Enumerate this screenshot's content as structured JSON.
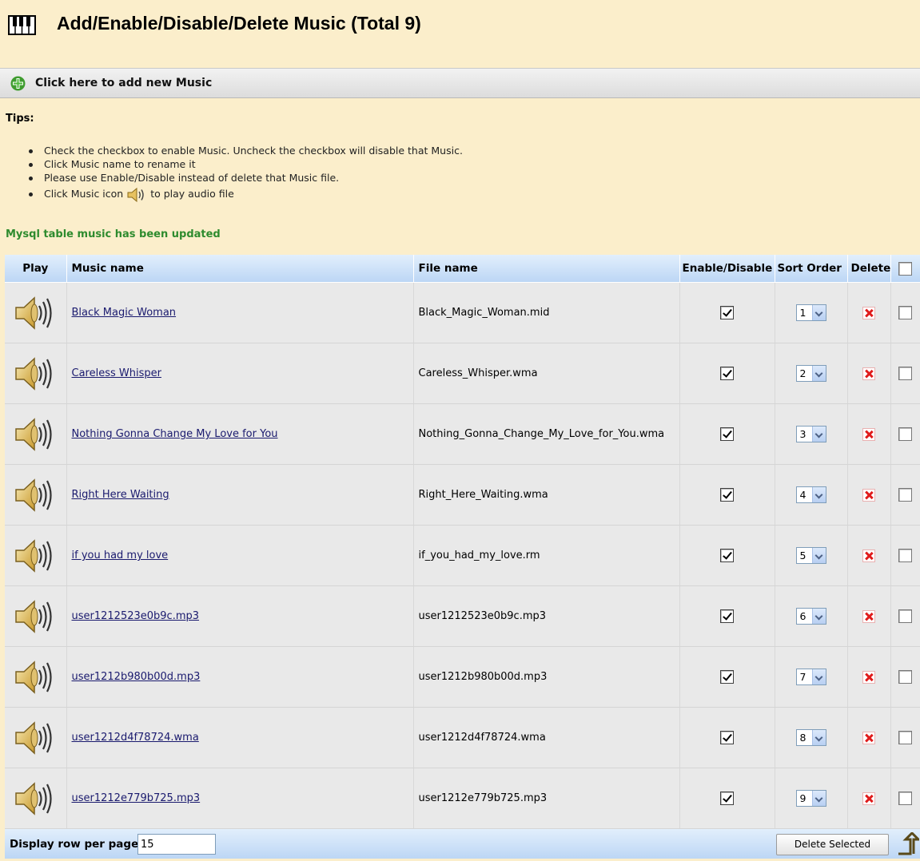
{
  "header": {
    "title": "Add/Enable/Disable/Delete Music (Total 9)",
    "icon": "piano-keys-icon"
  },
  "add_bar": {
    "label": "Click here to add new Music",
    "icon": "green-plus-icon"
  },
  "tips": {
    "title": "Tips:",
    "items": [
      "Check the checkbox to enable Music. Uncheck the checkbox will disable that Music.",
      "Click Music name to rename it",
      "Please use Enable/Disable instead of delete that Music file."
    ],
    "icon_tip_before": "Click Music icon",
    "icon_tip_after": "to play audio file"
  },
  "status_message": "Mysql table music has been updated",
  "status_color": "#2e8b2e",
  "table": {
    "columns": {
      "play": "Play",
      "music_name": "Music name",
      "file_name": "File name",
      "enable": "Enable/Disable",
      "sort_order": "Sort Order",
      "delete": "Delete"
    },
    "select_all_checked": false,
    "rows": [
      {
        "music_name": "Black Magic Woman",
        "file_name": "Black_Magic_Woman.mid",
        "enabled": true,
        "sort_order": "1",
        "selected": false
      },
      {
        "music_name": "Careless Whisper",
        "file_name": "Careless_Whisper.wma",
        "enabled": true,
        "sort_order": "2",
        "selected": false
      },
      {
        "music_name": "Nothing Gonna Change My Love for You",
        "file_name": "Nothing_Gonna_Change_My_Love_for_You.wma",
        "enabled": true,
        "sort_order": "3",
        "selected": false
      },
      {
        "music_name": "Right Here Waiting",
        "file_name": "Right_Here_Waiting.wma",
        "enabled": true,
        "sort_order": "4",
        "selected": false
      },
      {
        "music_name": "if you had my love",
        "file_name": "if_you_had_my_love.rm",
        "enabled": true,
        "sort_order": "5",
        "selected": false
      },
      {
        "music_name": "user1212523e0b9c.mp3",
        "file_name": "user1212523e0b9c.mp3",
        "enabled": true,
        "sort_order": "6",
        "selected": false
      },
      {
        "music_name": "user1212b980b00d.mp3",
        "file_name": "user1212b980b00d.mp3",
        "enabled": true,
        "sort_order": "7",
        "selected": false
      },
      {
        "music_name": "user1212d4f78724.wma",
        "file_name": "user1212d4f78724.wma",
        "enabled": true,
        "sort_order": "8",
        "selected": false
      },
      {
        "music_name": "user1212e779b725.mp3",
        "file_name": "user1212e779b725.mp3",
        "enabled": true,
        "sort_order": "9",
        "selected": false
      }
    ]
  },
  "footer": {
    "rows_per_page_label": "Display row per page",
    "rows_per_page_value": "15",
    "delete_selected_label": "Delete Selected",
    "scroll_top_icon": "up-arrow-icon"
  }
}
